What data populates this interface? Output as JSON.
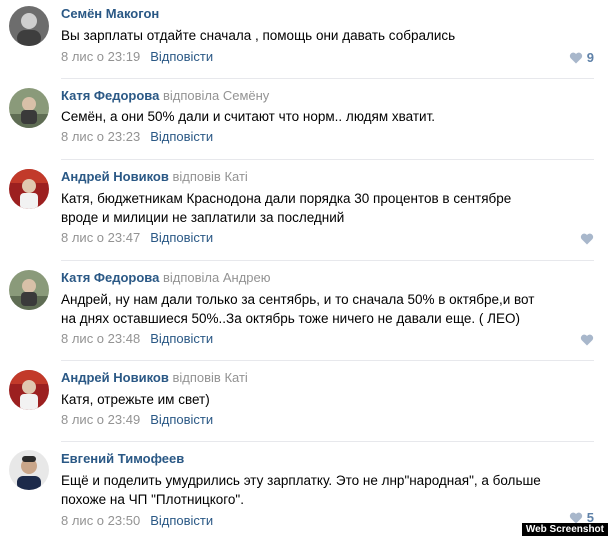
{
  "comments": [
    {
      "author": "Семён Макогон",
      "reply_to": "",
      "lines": [
        "Вы зарплаты отдайте сначала , помощь они давать собрались"
      ],
      "date": "8 лис о 23:19",
      "reply_label": "Відповісти",
      "likes": "9"
    },
    {
      "author": "Катя Федорова",
      "reply_to": "відповіла Семёну",
      "lines": [
        "Семён, а они 50% дали и считают что норм.. людям хватит."
      ],
      "date": "8 лис о 23:23",
      "reply_label": "Відповісти",
      "likes": ""
    },
    {
      "author": "Андрей Новиков",
      "reply_to": "відповів Каті",
      "lines": [
        "Катя, бюджетникам Краснодона дали порядка 30 процентов в сентябре",
        "вроде и милиции не заплатили за последний"
      ],
      "date": "8 лис о 23:47",
      "reply_label": "Відповісти",
      "likes": ""
    },
    {
      "author": "Катя Федорова",
      "reply_to": "відповіла Андрею",
      "lines": [
        "Андрей, ну нам дали только за сентябрь, и то сначала 50% в октябре,и вот",
        "на днях оставшиеся 50%..За октябрь тоже ничего не давали еще. ( ЛЕО)"
      ],
      "date": "8 лис о 23:48",
      "reply_label": "Відповісти",
      "likes": ""
    },
    {
      "author": "Андрей Новиков",
      "reply_to": "відповів Каті",
      "lines": [
        "Катя, отрежьте им свет)"
      ],
      "date": "8 лис о 23:49",
      "reply_label": "Відповісти",
      "likes": ""
    },
    {
      "author": "Евгений Тимофеев",
      "reply_to": "",
      "lines": [
        "Ещё и поделить умудрились эту зарплатку. Это не лнр\"народная\", а больше",
        "похоже на ЧП \"Плотницкого\"."
      ],
      "date": "8 лис о 23:50",
      "reply_label": "Відповісти",
      "likes": "5"
    }
  ],
  "watermark": "Web Screenshot",
  "colors": {
    "author": "#2a5885",
    "muted": "#939393",
    "like_heart": "#a8b7cb",
    "divider": "#e7e8ec"
  }
}
